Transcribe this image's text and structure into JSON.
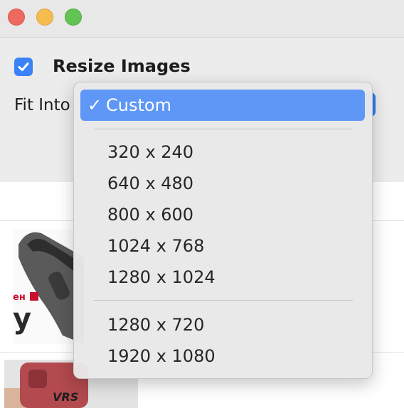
{
  "window": {
    "traffic_lights": [
      "close",
      "minimize",
      "zoom"
    ]
  },
  "options": {
    "resize_checked": true,
    "resize_label": "Resize Images",
    "fit_into_label": "Fit Into"
  },
  "menu": {
    "selected_check": "✓",
    "selected": "Custom",
    "group1": [
      "320 x 240",
      "640 x 480",
      "800 x 600",
      "1024 x 768",
      "1280 x 1024"
    ],
    "group2": [
      "1280 x 720",
      "1920 x 1080"
    ]
  },
  "colors": {
    "accent": "#3b82f6",
    "menu_highlight": "#5e97f6"
  }
}
